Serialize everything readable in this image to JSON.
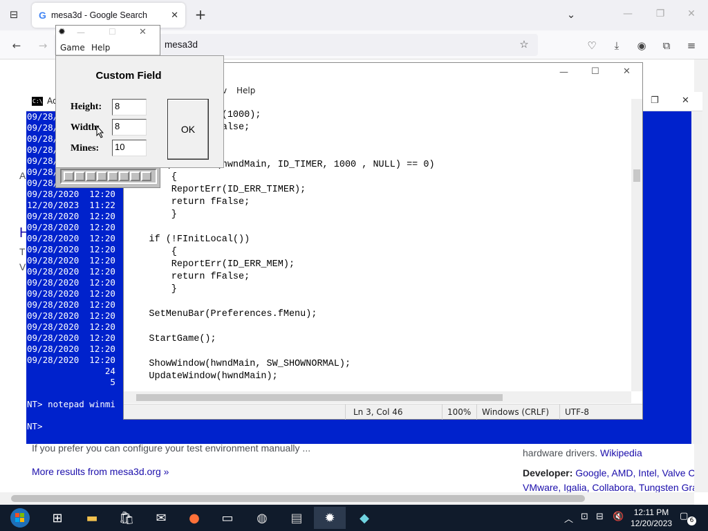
{
  "browser": {
    "tab_title": "mesa3d - Google Search",
    "url": "mesa3d",
    "new_tab": "+",
    "content": {
      "lead_char_a": "A",
      "lead_char_h": "H",
      "lead_char_t": "T",
      "lead_char_v": "V",
      "manual_text": "If you prefer you can configure your test environment manually ...",
      "more_results": "More results from mesa3d.org »",
      "hardware_text": "hardware drivers.",
      "wikipedia": "Wikipedia",
      "developer_label": "Developer:",
      "developer_list": "Google, AMD, Intel, Valve C",
      "developer_list2": "VMware, Igalia, Collabora, Tungsten Gra"
    }
  },
  "console": {
    "title": "Ad",
    "lines": [
      "09/28/2020  12:20",
      "09/28/2020  12:20",
      "09/28/2020  12:20",
      "09/28/2020  12:20",
      "09/28/2020  12:20",
      "09/28/2020  12:20",
      "09/28/2020  12:20",
      "09/28/2020  12:20",
      "12/20/2023  11:22",
      "09/28/2020  12:20",
      "09/28/2020  12:20",
      "09/28/2020  12:20",
      "09/28/2020  12:20",
      "09/28/2020  12:20",
      "09/28/2020  12:20",
      "09/28/2020  12:20",
      "09/28/2020  12:20",
      "09/28/2020  12:20",
      "09/28/2020  12:20",
      "09/28/2020  12:20",
      "09/28/2020  12:20",
      "09/28/2020  12:20",
      "09/28/2020  12:20",
      "               24",
      "                5",
      "",
      "NT> notepad winmi",
      "",
      "NT>"
    ]
  },
  "notepad": {
    "menu_view": "v",
    "menu_help": "Help",
    "code": "        ReportErr(1000);\n        return fFalse;\n        }\n\n    if (SetTimer(hwndMain, ID_TIMER, 1000 , NULL) == 0)\n        {\n        ReportErr(ID_ERR_TIMER);\n        return fFalse;\n        }\n\n    if (!FInitLocal())\n        {\n        ReportErr(ID_ERR_MEM);\n        return fFalse;\n        }\n\n    SetMenuBar(Preferences.fMenu);\n\n    StartGame();\n\n    ShowWindow(hwndMain, SW_SHOWNORMAL);\n    UpdateWindow(hwndMain);",
    "status": {
      "position": "Ln 3, Col 46",
      "zoom": "100%",
      "line_ending": "Windows (CRLF)",
      "encoding": "UTF-8"
    }
  },
  "minesweeper": {
    "menu_game": "Game",
    "menu_help": "Help"
  },
  "dialog": {
    "title": "Custom Field",
    "height_label": "Height:",
    "height_value": "8",
    "width_label": "Width:",
    "width_value": "8",
    "mines_label": "Mines:",
    "mines_value": "10",
    "ok_label": "OK"
  },
  "taskbar": {
    "time": "12:11 PM",
    "date": "12/20/2023",
    "notification_count": "6"
  },
  "colors": {
    "console_bg": "#0022cc",
    "taskbar_bg": "#101b2b",
    "link": "#1a0dab"
  }
}
